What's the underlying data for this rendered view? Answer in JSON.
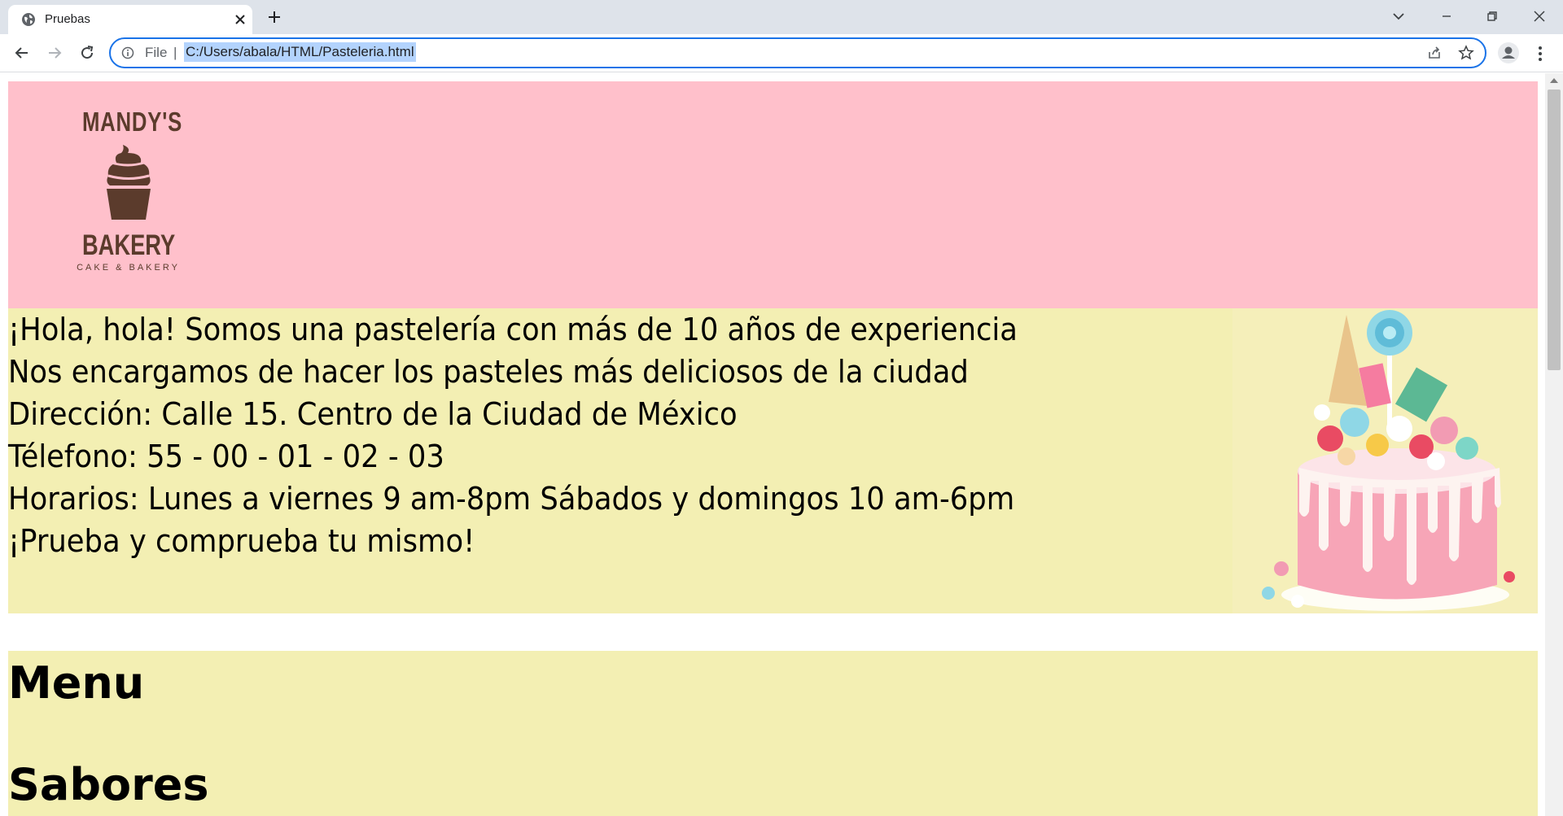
{
  "browser": {
    "tab_title": "Pruebas",
    "address_scheme": "File",
    "address_separator": "|",
    "url": "C:/Users/abala/HTML/Pasteleria.html",
    "accent_color": "#1a73e8"
  },
  "header": {
    "background": "#ffc0cb",
    "logo": {
      "top_text": "MANDY'S",
      "main_text": "BAKERY",
      "sub_text": "CAKE & BAKERY",
      "icon": "cupcake-icon",
      "color": "#5b3b2c"
    }
  },
  "about": {
    "background": "#f3efb3",
    "lines": [
      "¡Hola, hola! Somos una pastelería con más de 10 años de experiencia",
      "Nos encargamos de hacer los pasteles más deliciosos de la ciudad",
      "Dirección: Calle 15. Centro de la Ciudad de México",
      "Télefono: 55 - 00 - 01 - 02 - 03",
      "Horarios: Lunes a viernes 9 am-8pm Sábados y domingos 10 am-6pm",
      "¡Prueba y comprueba tu mismo!"
    ],
    "image": "drip-cake-photo"
  },
  "menu": {
    "heading": "Menu",
    "subheading": "Sabores"
  }
}
